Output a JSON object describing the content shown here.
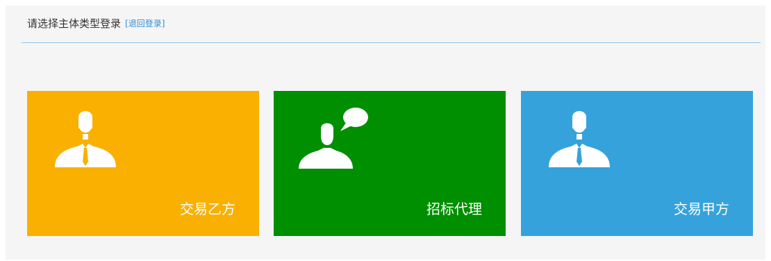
{
  "header": {
    "title": "请选择主体类型登录",
    "back_link": "[退回登录]"
  },
  "tiles": [
    {
      "label": "交易乙方",
      "color": "#f9b000",
      "icon": "person-tie-icon"
    },
    {
      "label": "招标代理",
      "color": "#008f00",
      "icon": "person-speech-icon"
    },
    {
      "label": "交易甲方",
      "color": "#36a2dc",
      "icon": "person-tie-icon"
    }
  ]
}
